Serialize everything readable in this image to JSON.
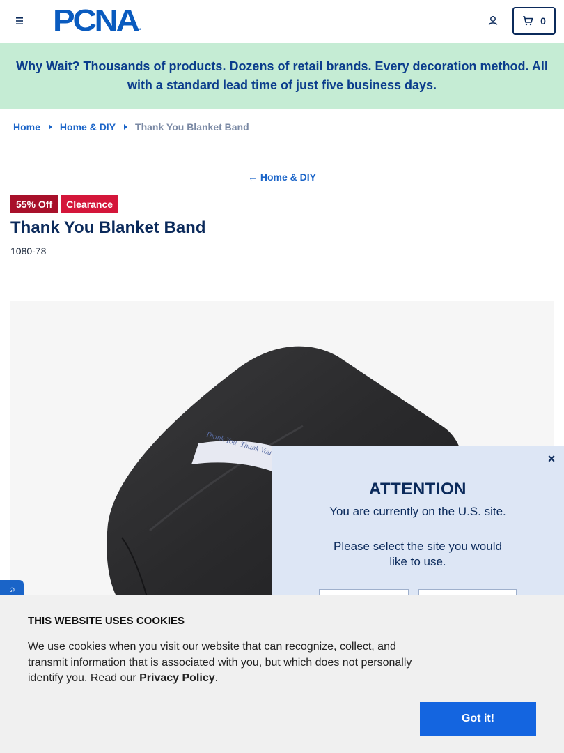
{
  "header": {
    "logo_text": "PCNA",
    "logo_tm": "™",
    "cart_count": "0"
  },
  "promo": {
    "text": "Why Wait? Thousands of products. Dozens of retail brands. Every decoration method. All with a standard lead time of just five business days."
  },
  "breadcrumb": {
    "items": [
      {
        "label": "Home"
      },
      {
        "label": "Home & DIY"
      }
    ],
    "current": "Thank You Blanket Band"
  },
  "back_link": {
    "arrow": "←",
    "label": "Home & DIY"
  },
  "product": {
    "badges": [
      {
        "label": "55% Off",
        "color": "#a8102a"
      },
      {
        "label": "Clearance",
        "color": "#d4163a"
      }
    ],
    "title": "Thank You Blanket Band",
    "sku": "1080-78",
    "band_text": "Thank You  Thank You"
  },
  "side_tab": {
    "label": "GI"
  },
  "modal": {
    "close_glyph": "×",
    "title": "ATTENTION",
    "line1": "You are currently on the U.S. site.",
    "line2": "Please select the site you would like to use."
  },
  "cookie": {
    "title": "THIS WEBSITE USES COOKIES",
    "text_before": "We use cookies when you visit our website that can recognize, collect, and transmit information that is associated with you, but which does not personally identify you. Read our ",
    "link": "Privacy Policy",
    "text_after": ".",
    "button": "Got it!"
  },
  "colors": {
    "brand_blue": "#0a5bbf",
    "navy": "#0b2a5b",
    "promo_bg": "#c5ecd4",
    "cookie_button": "#1465e0"
  },
  "icons": {
    "menu": "hamburger-icon",
    "account": "user-icon",
    "cart": "cart-icon",
    "close": "close-icon",
    "back": "arrow-left-icon"
  }
}
